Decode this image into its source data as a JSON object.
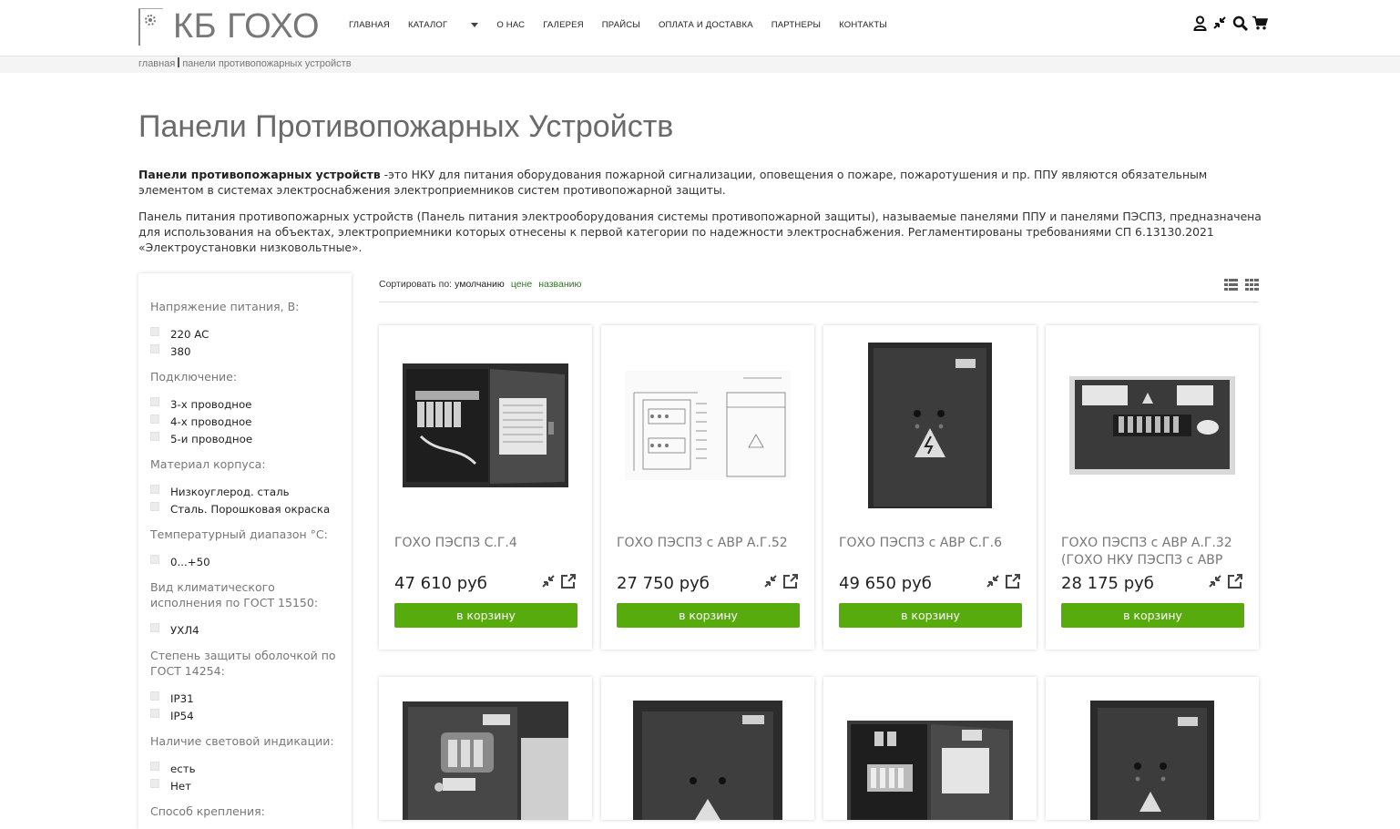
{
  "header": {
    "logo_text": "КБ ГОХО",
    "nav": [
      {
        "label": "ГЛАВНАЯ"
      },
      {
        "label": "КАТАЛОГ"
      },
      {
        "label": "О НАС"
      },
      {
        "label": "ГАЛЕРЕЯ"
      },
      {
        "label": "ПРАЙСЫ"
      },
      {
        "label": "ОПЛАТА И ДОСТАВКА"
      },
      {
        "label": "ПАРТНЕРЫ"
      },
      {
        "label": "КОНТАКТЫ"
      }
    ],
    "tools": [
      "user-icon",
      "compare-icon",
      "search-icon",
      "cart-icon"
    ]
  },
  "breadcrumb": {
    "home": "главная",
    "current": "панели противопожарных устройств"
  },
  "page": {
    "title": "Панели Противопожарных Устройств",
    "intro_bold": "Панели противопожарных устройств",
    "intro_rest": " -это НКУ для питания оборудования пожарной сигнализации, оповещения о пожаре, пожаротушения и пр. ППУ являются обязательным элементом в системах электроснабжения электроприемников систем противопожарной защиты.",
    "intro_p2": "Панель питания противопожарных устройств (Панель питания электрооборудования системы противопожарной защиты), называемые панелями ППУ и панелями ПЭСПЗ, предназначена для использования на объектах, электроприемники которых отнесены к первой категории по надежности электроснабжения. Регламентированы требованиями СП 6.13130.2021 «Электроустановки низковольтные»."
  },
  "filters": [
    {
      "title": "Напряжение питания, В:",
      "options": [
        "220 AC",
        "380"
      ]
    },
    {
      "title": "Подключение:",
      "options": [
        "3-х проводное",
        "4-х проводное",
        "5-и проводное"
      ]
    },
    {
      "title": "Материал корпуса:",
      "options": [
        "Низкоуглерод. сталь",
        "Сталь. Порошковая окраска"
      ]
    },
    {
      "title": "Температурный диапазон °С:",
      "options": [
        "0...+50"
      ]
    },
    {
      "title": "Вид климатического исполнения по ГОСТ 15150:",
      "options": [
        "УХЛ4"
      ]
    },
    {
      "title": "Степень защиты оболочкой по ГОСТ 14254:",
      "options": [
        "IP31",
        "IP54"
      ]
    },
    {
      "title": "Наличие световой индикации:",
      "options": [
        "есть",
        "Нет"
      ]
    },
    {
      "title": "Способ крепления:",
      "options": []
    }
  ],
  "sort": {
    "label": "Сортировать по:",
    "default": "умолчанию",
    "by_price": "цене",
    "by_name": "названию"
  },
  "products": [
    {
      "name": "ГОХО ПЭСПЗ С.Г.4",
      "price": "47 610 руб",
      "button": "в корзину"
    },
    {
      "name": "ГОХО ПЭСПЗ с АВР А.Г.52",
      "price": "27 750 руб",
      "button": "в корзину"
    },
    {
      "name": "ГОХО ПЭСПЗ с АВР С.Г.6",
      "price": "49 650 руб",
      "button": "в корзину"
    },
    {
      "name": "ГОХО ПЭСПЗ с АВР А.Г.32 (ГОХО НКУ ПЭСПЗ с АВР",
      "price": "28 175 руб",
      "button": "в корзину"
    },
    {
      "name": "",
      "price": "",
      "button": ""
    },
    {
      "name": "",
      "price": "",
      "button": ""
    },
    {
      "name": "",
      "price": "",
      "button": ""
    },
    {
      "name": "",
      "price": "",
      "button": ""
    }
  ]
}
